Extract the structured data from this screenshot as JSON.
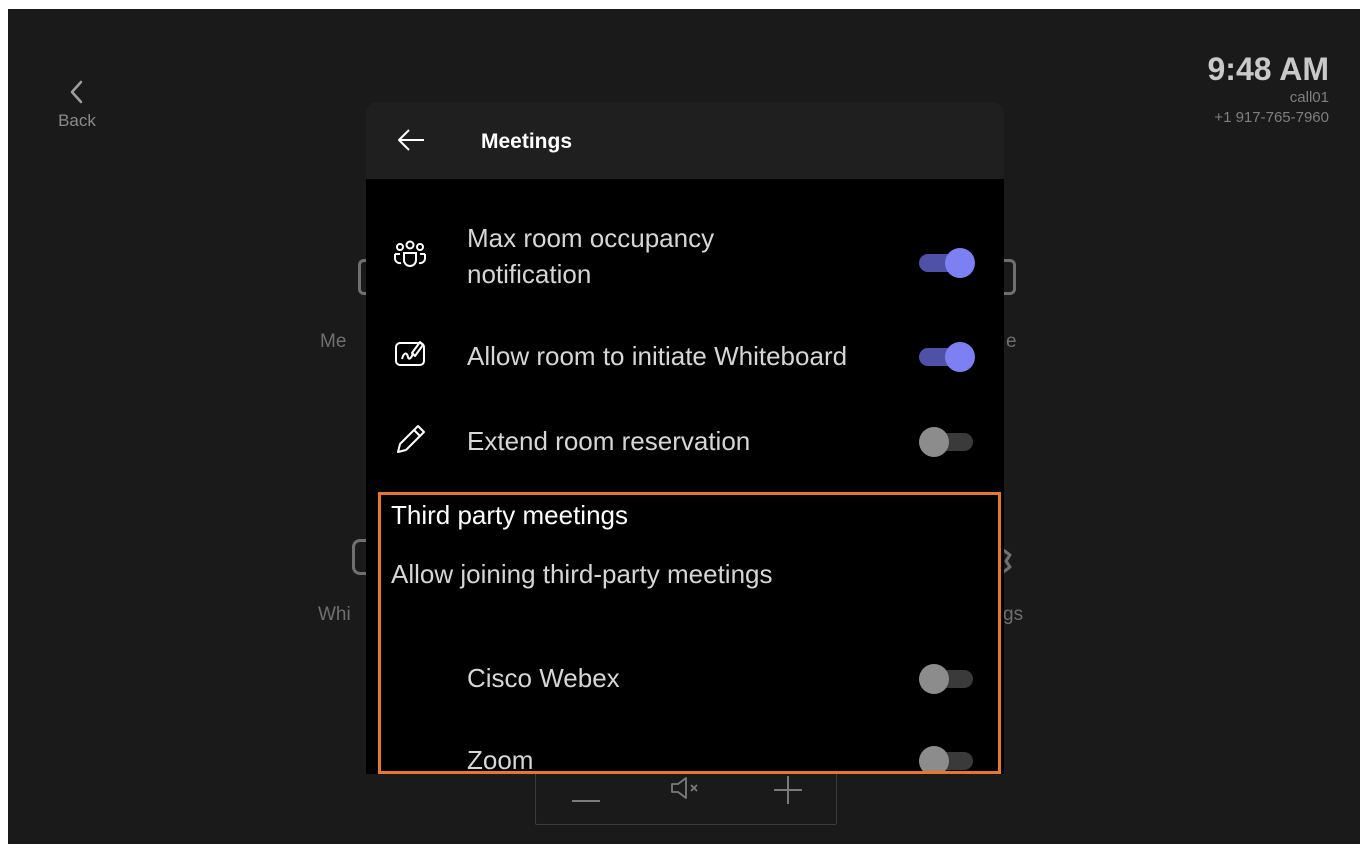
{
  "back": {
    "label": "Back"
  },
  "status": {
    "time": "9:48 AM",
    "device_name": "call01",
    "phone": "+1 917-765-7960"
  },
  "background_tiles": {
    "left_top": "Me",
    "right_top": "e",
    "left_bottom": "Whi",
    "right_bottom": "gs"
  },
  "panel": {
    "title": "Meetings",
    "settings": [
      {
        "label": "Max room occupancy notification",
        "line1": "Max room occupancy",
        "line2": "notification",
        "icon": "people-group-icon",
        "enabled": true
      },
      {
        "label": "Allow room to initiate Whiteboard",
        "icon": "whiteboard-icon",
        "enabled": true
      },
      {
        "label": "Extend room reservation",
        "icon": "pencil-icon",
        "enabled": false
      }
    ],
    "third_party": {
      "title": "Third party meetings",
      "subtitle": "Allow joining third-party meetings",
      "providers": [
        {
          "label": "Cisco Webex",
          "enabled": false
        },
        {
          "label": "Zoom",
          "enabled": false
        }
      ]
    }
  },
  "colors": {
    "accent": "#7c80f2",
    "highlight": "#e8762b",
    "panel_bg": "#000000",
    "screen_bg": "#1a1a1a"
  }
}
